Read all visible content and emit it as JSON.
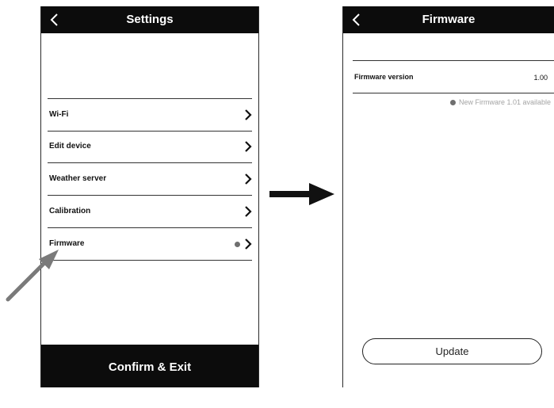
{
  "settings": {
    "title": "Settings",
    "items": [
      {
        "label": "Wi-Fi"
      },
      {
        "label": "Edit device"
      },
      {
        "label": "Weather server"
      },
      {
        "label": "Calibration"
      },
      {
        "label": "Firmware",
        "has_update_dot": true
      }
    ],
    "confirm_label": "Confirm & Exit"
  },
  "firmware": {
    "title": "Firmware",
    "version_label": "Firmware version",
    "version_value": "1.00",
    "update_note": "New Firmware 1.01 available",
    "update_button": "Update"
  },
  "icons": {
    "back": "chevron-left-icon",
    "row_chevron": "chevron-right-icon",
    "update_indicator": "dot-icon",
    "flow_arrow": "arrow-right-icon",
    "pointer": "pointer-arrow-icon"
  },
  "colors": {
    "header_bg": "#0c0c0c",
    "indicator_dot": "#6f6f6f",
    "note_text": "#a4a4a4",
    "pointer_arrow": "#7a7a7a"
  }
}
